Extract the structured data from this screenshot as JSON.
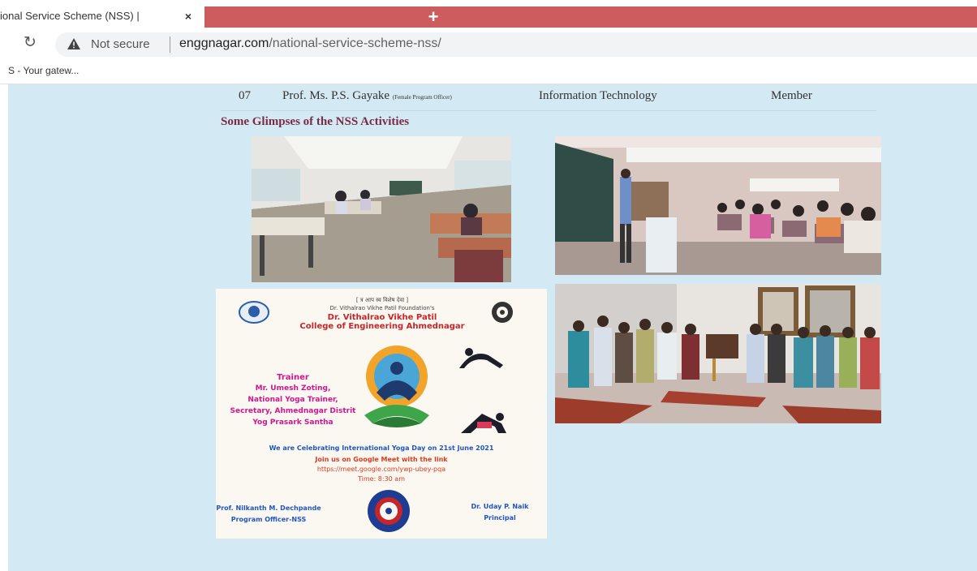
{
  "browser": {
    "tab_title": "ional Service Scheme (NSS) |",
    "tab_close": "×",
    "new_tab": "+",
    "security_label": "Not secure",
    "url_domain": "enggnagar.com",
    "url_path": "/national-service-scheme-nss/",
    "bookmark_label": "S - Your gatew..."
  },
  "table_row": {
    "sr": "07",
    "name": "Prof. Ms. P.S. Gayake",
    "name_note": "(Female Program Officer)",
    "department": "Information Technology",
    "role": "Member"
  },
  "section_title": "Some Glimpses of the NSS Activities",
  "poster": {
    "top_line": "[ त्र आप स्व विशेष देवा ]",
    "foundation": "Dr. Vithalrao Vikhe Patil Foundation's",
    "college_line1": "Dr. Vithalrao Vikhe Patil",
    "college_line2": "College of Engineering Ahmednagar",
    "trainer_heading": "Trainer",
    "trainer_lines": [
      "Mr. Umesh Zoting,",
      "National Yoga Trainer,",
      "Secretary, Ahmednagar Distrit",
      "Yog Prasark Santha"
    ],
    "celebration": "We are Celebrating International Yoga Day on 21st June 2021",
    "join": "Join us on Google Meet with the link",
    "link": "https://meet.google.com/ywp-ubey-pqa",
    "time": "Time: 8:30 am",
    "left_sign1": "Prof. Nilkanth M. Dechpande",
    "left_sign2": "Program Officer-NSS",
    "right_sign1": "Dr. Uday P. Naik",
    "right_sign2": "Principal"
  },
  "colors": {
    "tab_bar": "#cd5c5f",
    "page_bg": "#d3e9f4",
    "section_title": "#7a2b48",
    "poster_pink": "#d4148c",
    "poster_blue": "#1f55c4",
    "poster_red": "#c7252a"
  },
  "icons": {
    "reload": "reload-icon",
    "warning": "warning-triangle-icon",
    "close": "close-icon",
    "new_tab": "plus-icon"
  }
}
